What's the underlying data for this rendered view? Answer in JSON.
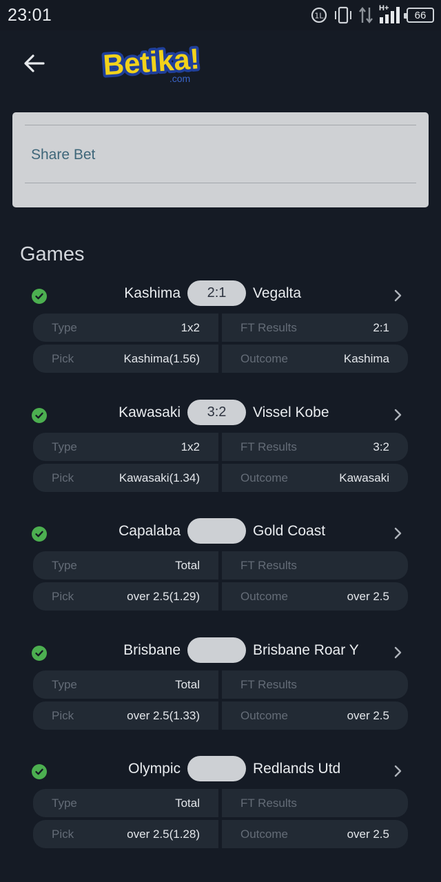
{
  "status_bar": {
    "time": "23:01",
    "network_label": "H+",
    "battery": "66",
    "icons": [
      "clock-icon",
      "vibrate-icon",
      "data-arrows-icon",
      "signal-icon",
      "battery-icon"
    ]
  },
  "header": {
    "back_icon": "arrow-left-icon",
    "logo_text": "Betika!",
    "logo_sub": ".com",
    "colors": {
      "logo_yellow": "#f2d21b",
      "logo_blue": "#1f3f9a"
    }
  },
  "share": {
    "label": "Share Bet"
  },
  "games_title": "Games",
  "labels": {
    "type": "Type",
    "ft_results": "FT Results",
    "pick": "Pick",
    "outcome": "Outcome"
  },
  "games": [
    {
      "home": "Kashima",
      "away": "Vegalta",
      "score": "2:1",
      "type": "1x2",
      "ft_result": "2:1",
      "pick": "Kashima(1.56)",
      "outcome": "Kashima"
    },
    {
      "home": "Kawasaki",
      "away": "Vissel Kobe",
      "score": "3:2",
      "type": "1x2",
      "ft_result": "3:2",
      "pick": "Kawasaki(1.34)",
      "outcome": "Kawasaki"
    },
    {
      "home": "Capalaba",
      "away": "Gold Coast",
      "score": "",
      "type": "Total",
      "ft_result": "",
      "pick": "over 2.5(1.29)",
      "outcome": "over 2.5"
    },
    {
      "home": "Brisbane",
      "away": "Brisbane Roar Y",
      "score": "",
      "type": "Total",
      "ft_result": "",
      "pick": "over 2.5(1.33)",
      "outcome": "over 2.5"
    },
    {
      "home": "Olympic",
      "away": "Redlands Utd",
      "score": "",
      "type": "Total",
      "ft_result": "",
      "pick": "over 2.5(1.28)",
      "outcome": "over 2.5"
    }
  ],
  "colors": {
    "background": "#151b25",
    "cell": "#222a34",
    "check_green": "#4caf50",
    "share_link": "#3e6679"
  }
}
